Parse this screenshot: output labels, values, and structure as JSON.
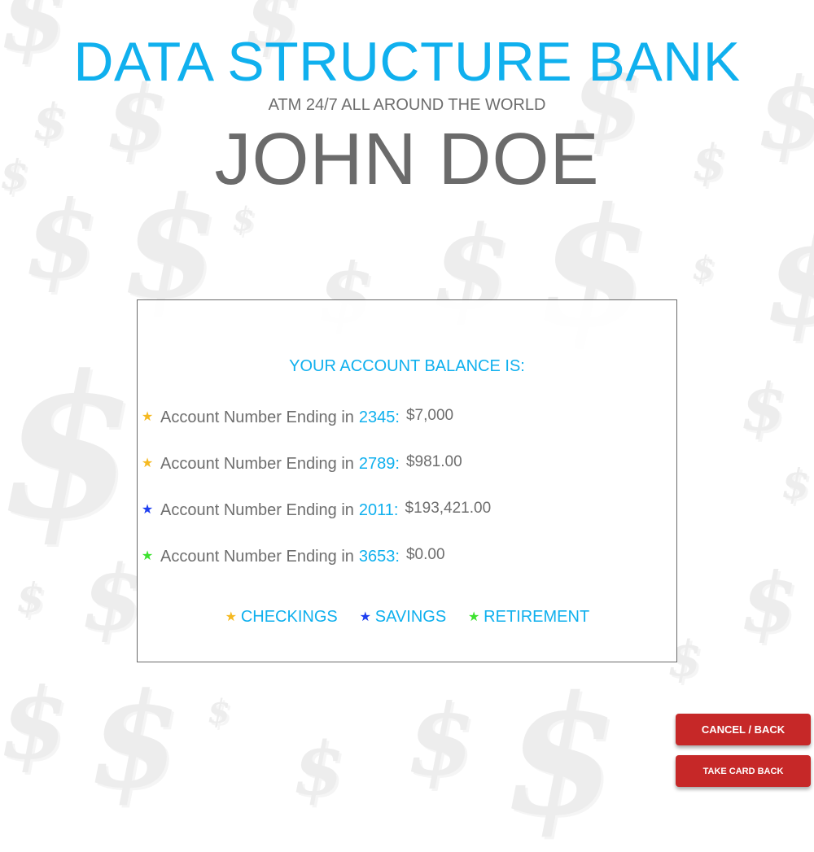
{
  "header": {
    "bank_name": "DATA STRUCTURE BANK",
    "tagline": "ATM 24/7 ALL AROUND THE WORLD",
    "customer_name": "JOHN DOE"
  },
  "balance_panel": {
    "heading": "YOUR ACCOUNT BALANCE IS:",
    "accounts": [
      {
        "label": "Account Number Ending in",
        "number": "2345:",
        "balance": "$7,000",
        "type": "checkings",
        "star_color": "#f5b921"
      },
      {
        "label": "Account Number Ending in",
        "number": "2789:",
        "balance": "$981.00",
        "type": "checkings",
        "star_color": "#f5b921"
      },
      {
        "label": "Account Number Ending in",
        "number": "2011:",
        "balance": "$193,421.00",
        "type": "savings",
        "star_color": "#1f3ff0"
      },
      {
        "label": "Account Number Ending in",
        "number": "3653:",
        "balance": "$0.00",
        "type": "retirement",
        "star_color": "#3de22f"
      }
    ],
    "legend": [
      {
        "label": "CHECKINGS",
        "star_color": "#f5b921"
      },
      {
        "label": "SAVINGS",
        "star_color": "#1f3ff0"
      },
      {
        "label": "RETIREMENT",
        "star_color": "#3de22f"
      }
    ]
  },
  "actions": {
    "cancel_label": "CANCEL / BACK",
    "take_card_label": "TAKE CARD BACK"
  },
  "icons": {
    "star_glyph": "★",
    "background_glyph": "$"
  },
  "colors": {
    "accent": "#10b0ee",
    "text_gray": "#6e6e6e",
    "button_red": "#c62828",
    "checkings": "#f5b921",
    "savings": "#1f3ff0",
    "retirement": "#3de22f"
  }
}
